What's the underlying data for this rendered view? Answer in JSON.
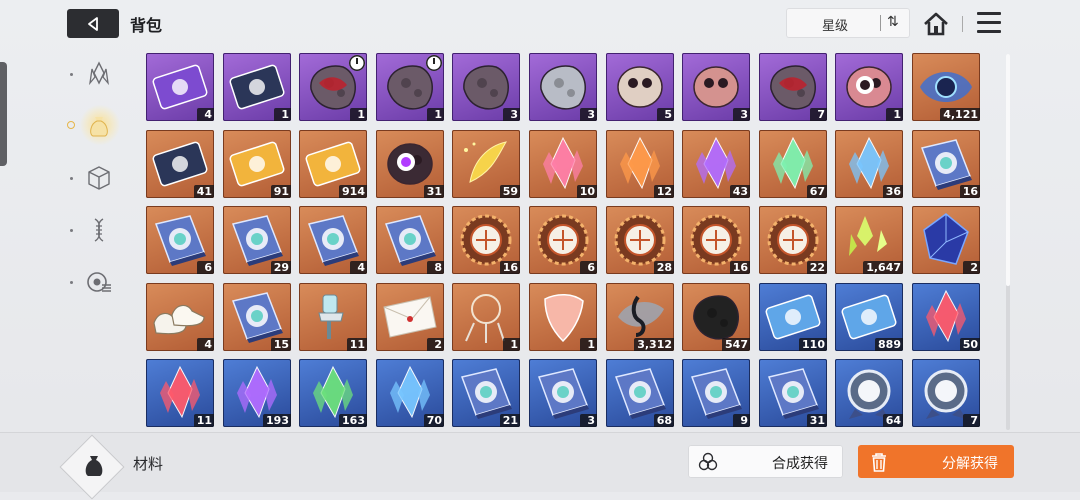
{
  "header": {
    "title": "背包",
    "sort_label": "星级",
    "sort_toggle_glyph": "⇅"
  },
  "side_nav": {
    "items": [
      {
        "icon": "crystal-icon",
        "active": false
      },
      {
        "icon": "pouch-icon",
        "active": true
      },
      {
        "icon": "cube-icon",
        "active": false
      },
      {
        "icon": "dna-icon",
        "active": false
      },
      {
        "icon": "chip-list-icon",
        "active": false
      }
    ]
  },
  "inventory": {
    "rows": [
      [
        {
          "icon": "purple-card-icon",
          "rarity": "purple",
          "count": "4"
        },
        {
          "icon": "document-card-icon",
          "rarity": "purple",
          "count": "1"
        },
        {
          "icon": "red-core-ore-icon",
          "rarity": "purple",
          "count": "1",
          "timed": true
        },
        {
          "icon": "dark-ore-icon",
          "rarity": "purple",
          "count": "1",
          "timed": true
        },
        {
          "icon": "dark-ore-icon",
          "rarity": "purple",
          "count": "3"
        },
        {
          "icon": "silver-ore-icon",
          "rarity": "purple",
          "count": "3"
        },
        {
          "icon": "skull-creature-icon",
          "rarity": "purple",
          "count": "5"
        },
        {
          "icon": "pink-blob-icon",
          "rarity": "purple",
          "count": "3"
        },
        {
          "icon": "red-core-ore-icon",
          "rarity": "purple",
          "count": "7"
        },
        {
          "icon": "eyeball-creature-icon",
          "rarity": "purple",
          "count": "1"
        },
        {
          "icon": "blue-flame-eye-icon",
          "rarity": "orange",
          "count": "4,121"
        }
      ],
      [
        {
          "icon": "dark-chip-icon",
          "rarity": "orange",
          "count": "41"
        },
        {
          "icon": "gold-ticket-icon",
          "rarity": "orange",
          "count": "91"
        },
        {
          "icon": "gold-ticket-star-icon",
          "rarity": "orange",
          "count": "914"
        },
        {
          "icon": "purple-eye-orb-icon",
          "rarity": "orange",
          "count": "31"
        },
        {
          "icon": "golden-feather-icon",
          "rarity": "orange",
          "count": "59"
        },
        {
          "icon": "pink-crystal-icon",
          "rarity": "orange",
          "count": "10"
        },
        {
          "icon": "orange-crystal-icon",
          "rarity": "orange",
          "count": "12"
        },
        {
          "icon": "purple-crystal-icon",
          "rarity": "orange",
          "count": "43"
        },
        {
          "icon": "rainbow-crystal-icon",
          "rarity": "orange",
          "count": "67"
        },
        {
          "icon": "blue-crystal-icon",
          "rarity": "orange",
          "count": "36"
        },
        {
          "icon": "rainbow-book-icon",
          "rarity": "orange",
          "count": "16"
        }
      ],
      [
        {
          "icon": "shield-book-icon",
          "rarity": "orange",
          "count": "6"
        },
        {
          "icon": "eye-book-icon",
          "rarity": "orange",
          "count": "29"
        },
        {
          "icon": "wing-book-icon",
          "rarity": "orange",
          "count": "4"
        },
        {
          "icon": "target-book-icon",
          "rarity": "orange",
          "count": "8"
        },
        {
          "icon": "gear-medal-icon",
          "rarity": "orange",
          "count": "16"
        },
        {
          "icon": "gear-medal-shield-icon",
          "rarity": "orange",
          "count": "6"
        },
        {
          "icon": "gear-medal-eye-icon",
          "rarity": "orange",
          "count": "28"
        },
        {
          "icon": "gear-medal-wing-icon",
          "rarity": "orange",
          "count": "16"
        },
        {
          "icon": "gear-medal-target-icon",
          "rarity": "orange",
          "count": "22"
        },
        {
          "icon": "green-shard-icon",
          "rarity": "orange",
          "count": "1,647"
        },
        {
          "icon": "blue-cube-gem-icon",
          "rarity": "orange",
          "count": "2"
        }
      ],
      [
        {
          "icon": "sneakers-icon",
          "rarity": "orange",
          "count": "4"
        },
        {
          "icon": "star-map-book-icon",
          "rarity": "orange",
          "count": "15"
        },
        {
          "icon": "spray-gun-icon",
          "rarity": "orange",
          "count": "11"
        },
        {
          "icon": "envelope-icon",
          "rarity": "orange",
          "count": "2"
        },
        {
          "icon": "dreamcatcher-icon",
          "rarity": "orange",
          "count": "1"
        },
        {
          "icon": "guitar-pick-icon",
          "rarity": "orange",
          "count": "1"
        },
        {
          "icon": "music-note-icon",
          "rarity": "orange",
          "count": "3,312"
        },
        {
          "icon": "black-flower-icon",
          "rarity": "orange",
          "count": "547"
        },
        {
          "icon": "blue-ticket-icon",
          "rarity": "blue",
          "count": "110"
        },
        {
          "icon": "blue-ticket-star-icon",
          "rarity": "blue",
          "count": "889"
        },
        {
          "icon": "red-crystal-icon",
          "rarity": "blue",
          "count": "50"
        }
      ],
      [
        {
          "icon": "red-crystal-icon",
          "rarity": "blue",
          "count": "11"
        },
        {
          "icon": "purple-crystal-icon",
          "rarity": "blue",
          "count": "193"
        },
        {
          "icon": "green-crystal-icon",
          "rarity": "blue",
          "count": "163"
        },
        {
          "icon": "blue-crystal-icon",
          "rarity": "blue",
          "count": "70"
        },
        {
          "icon": "rainbow-book-icon",
          "rarity": "blue",
          "count": "21"
        },
        {
          "icon": "shield-book-icon",
          "rarity": "blue",
          "count": "3"
        },
        {
          "icon": "eye-book-icon",
          "rarity": "blue",
          "count": "68"
        },
        {
          "icon": "wing-book-icon",
          "rarity": "blue",
          "count": "9"
        },
        {
          "icon": "target-book-icon",
          "rarity": "blue",
          "count": "31"
        },
        {
          "icon": "silver-medal-icon",
          "rarity": "blue",
          "count": "64"
        },
        {
          "icon": "silver-medal-target-icon",
          "rarity": "blue",
          "count": "7"
        }
      ]
    ]
  },
  "footer": {
    "category_label": "材料",
    "synthesize_label": "合成获得",
    "decompose_label": "分解获得"
  },
  "colors": {
    "accent_orange": "#f0742a",
    "rarity_orange": "#c2703f",
    "rarity_purple": "#8a55c4",
    "rarity_blue": "#3b63b8"
  }
}
